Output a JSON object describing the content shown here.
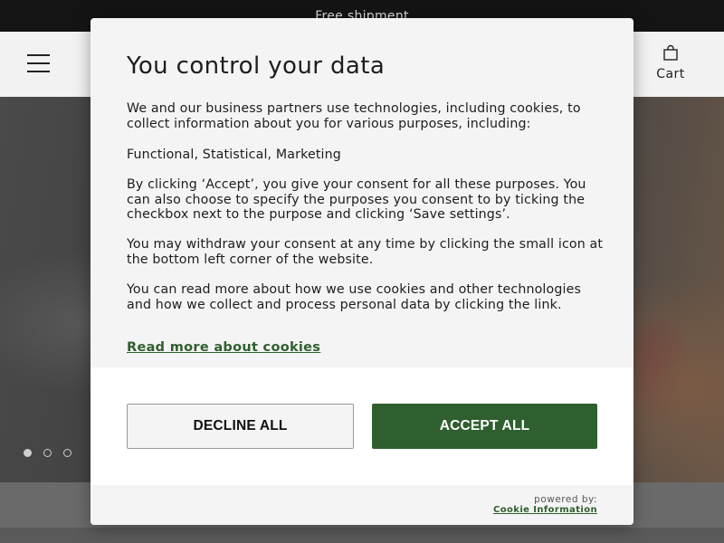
{
  "topbar": {
    "text": "Free shipment"
  },
  "header": {
    "menu_icon": "hamburger-icon",
    "cart": {
      "icon": "shopping-bag-icon",
      "label": "Cart"
    }
  },
  "carousel": {
    "slide_count": 3,
    "active_index": 0
  },
  "dialog": {
    "title": "You control your data",
    "intro": "We and our business partners use technologies, including cookies, to collect information about you for various purposes, including:",
    "purposes": "Functional, Statistical, Marketing",
    "consent_text": "By clicking ‘Accept’, you give your consent for all these purposes. You can also choose to specify the purposes you consent to by ticking the checkbox next to the purpose and clicking ‘Save settings’.",
    "withdraw_text": "You may withdraw your consent at any time by clicking the small icon at the bottom left corner of the website.",
    "read_more_text": "You can read more about how we use cookies and other technologies and how we collect and process personal data by clicking the link.",
    "read_more_link": "Read more about cookies",
    "decline_label": "DECLINE ALL",
    "accept_label": "ACCEPT ALL",
    "powered_by": "powered by:",
    "provider": "Cookie Information"
  },
  "colors": {
    "accent_green": "#2f5f2f",
    "topbar_bg": "#141414",
    "header_bg": "#f2f2f2",
    "dialog_bg": "#f4f4f4"
  }
}
